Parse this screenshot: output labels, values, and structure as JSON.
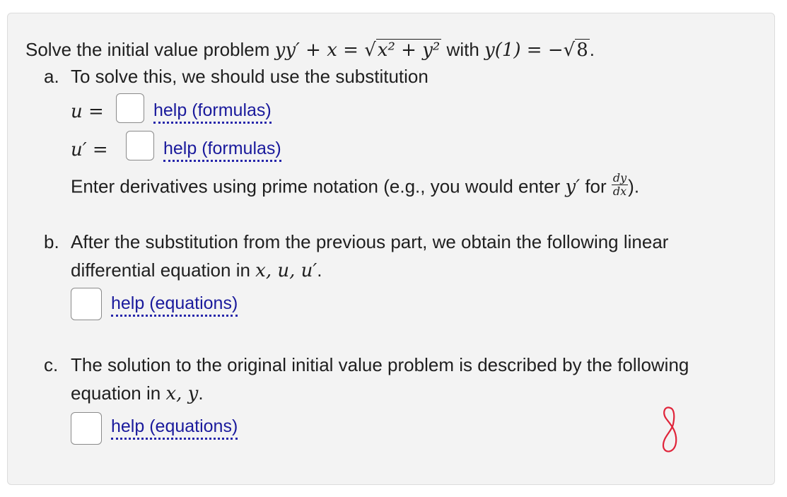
{
  "problem": {
    "prefix": "Solve the initial value problem ",
    "equation_left": "yy′ + x = ",
    "radicand": "x² + y²",
    "with_word": " with ",
    "condition_left": "y(1) = −",
    "condition_radicand": "8",
    "suffix": "."
  },
  "part_a": {
    "label": "a.",
    "text": "To solve this, we should use the substitution",
    "u_label": "u =",
    "uprime_label": "u′ =",
    "help_formulas_1": "help (formulas)",
    "help_formulas_2": "help (formulas)",
    "note_prefix": "Enter derivatives using prime notation (e.g., you would enter ",
    "note_var": "y′",
    "note_mid": " for ",
    "note_frac_num": "dy",
    "note_frac_den": "dx",
    "note_suffix": ")."
  },
  "part_b": {
    "label": "b.",
    "line1": "After the substitution from the previous part, we obtain the following linear",
    "line2_prefix": "differential equation in ",
    "line2_vars": "x, u, u′",
    "line2_suffix": ".",
    "help_equations": "help (equations)"
  },
  "part_c": {
    "label": "c.",
    "line1": "The solution to the original initial value problem is described by the following",
    "line2_prefix": "equation in ",
    "line2_vars": "x, y",
    "line2_suffix": ".",
    "help_equations": "help (equations)"
  },
  "annotation": {
    "handwritten_mark": "8",
    "color": "#e0243a"
  }
}
